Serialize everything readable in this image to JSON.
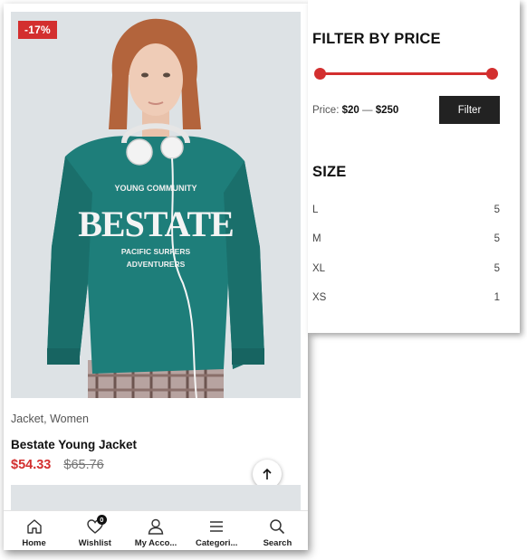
{
  "product": {
    "badge": "-17%",
    "categories": "Jacket, Women",
    "title": "Bestate Young Jacket",
    "price_sale": "$54.33",
    "price_old": "$65.76",
    "image_text": {
      "line1": "YOUNG COMMUNITY",
      "line2": "BESTATE",
      "line3": "PACIFIC SURFERS",
      "line4": "ADVENTURERS"
    }
  },
  "bottom_nav": [
    {
      "label": "Home",
      "icon": "home-icon"
    },
    {
      "label": "Wishlist",
      "icon": "heart-icon",
      "badge": "0"
    },
    {
      "label": "My Acco...",
      "icon": "user-icon"
    },
    {
      "label": "Categori...",
      "icon": "menu-icon"
    },
    {
      "label": "Search",
      "icon": "search-icon"
    }
  ],
  "filter": {
    "price_title": "FILTER BY PRICE",
    "price_label": "Price:",
    "price_min": "$20",
    "price_sep": " — ",
    "price_max": "$250",
    "button": "Filter",
    "size_title": "SIZE",
    "sizes": [
      {
        "label": "L",
        "count": "5"
      },
      {
        "label": "M",
        "count": "5"
      },
      {
        "label": "XL",
        "count": "5"
      },
      {
        "label": "XS",
        "count": "1"
      }
    ]
  },
  "colors": {
    "accent": "#d32f2f",
    "dark": "#222222",
    "sweater": "#1e7e7a"
  }
}
